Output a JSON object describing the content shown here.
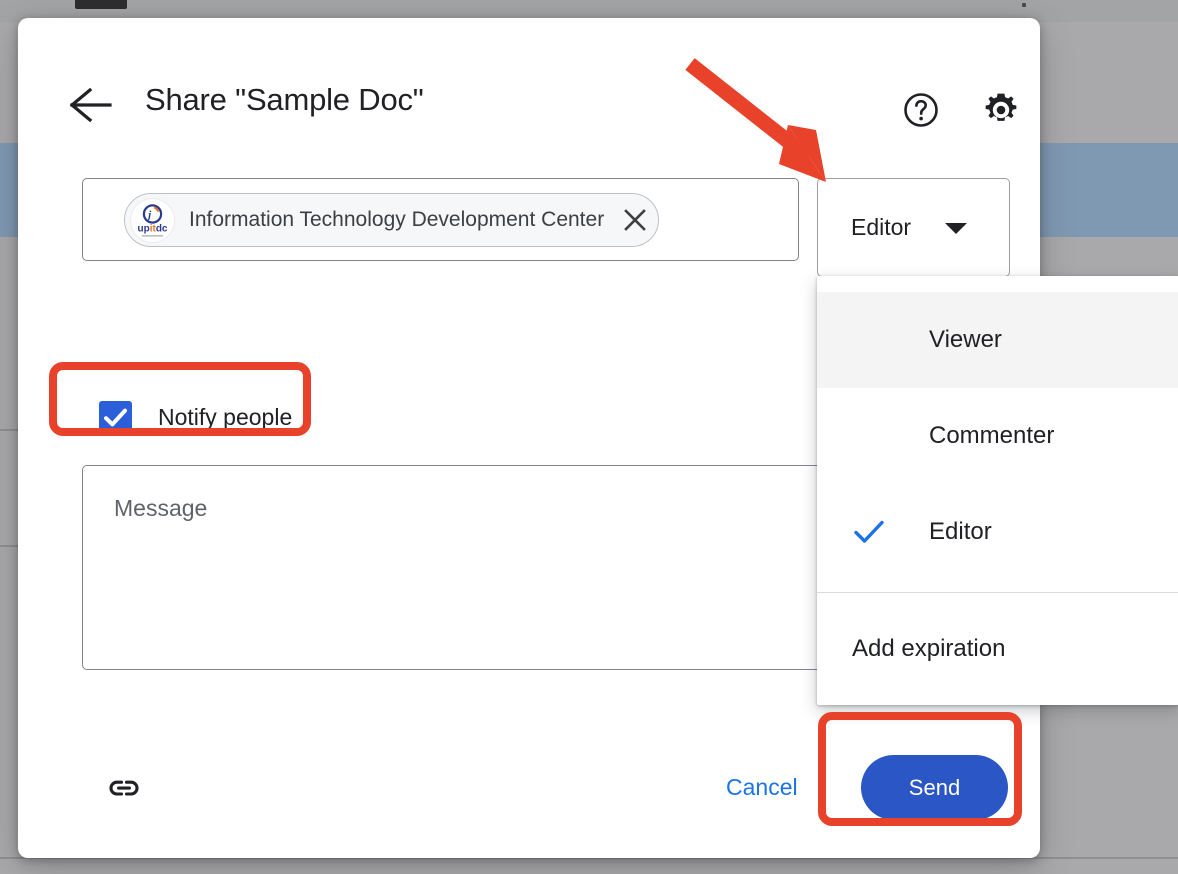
{
  "window": {
    "background_color": "#a9a9ab",
    "selected_row_color": "#8099b3"
  },
  "dialog": {
    "title": "Share \"Sample Doc\"",
    "back_button_name": "Back",
    "help_icon": "help-circle-icon",
    "settings_icon": "gear-icon"
  },
  "recipient": {
    "chip_label": "Information Technology Development Center",
    "chip_avatar_text": "upitdc",
    "chip_avatar_sub": "it",
    "remove_icon": "close-icon"
  },
  "role": {
    "selected": "Editor",
    "caret_icon": "chevron-down-icon",
    "menu": {
      "options": [
        {
          "label": "Viewer",
          "checked": false,
          "hovered": true
        },
        {
          "label": "Commenter",
          "checked": false,
          "hovered": false
        },
        {
          "label": "Editor",
          "checked": true,
          "hovered": false
        }
      ],
      "extra": {
        "label": "Add expiration"
      },
      "check_icon": "check-icon"
    }
  },
  "notify": {
    "label": "Notify people",
    "checked": true,
    "checkbox_color": "#2b5fd9"
  },
  "message": {
    "placeholder": "Message",
    "value": ""
  },
  "footer": {
    "link_icon": "link-icon",
    "cancel_label": "Cancel",
    "send_label": "Send",
    "send_color": "#2a56c6",
    "cancel_color": "#1a73e8"
  },
  "annotations": {
    "highlight_color": "#e8422a",
    "arrow_target": "role-dropdown-button",
    "boxes": [
      "notify-people-row",
      "send-button"
    ]
  }
}
